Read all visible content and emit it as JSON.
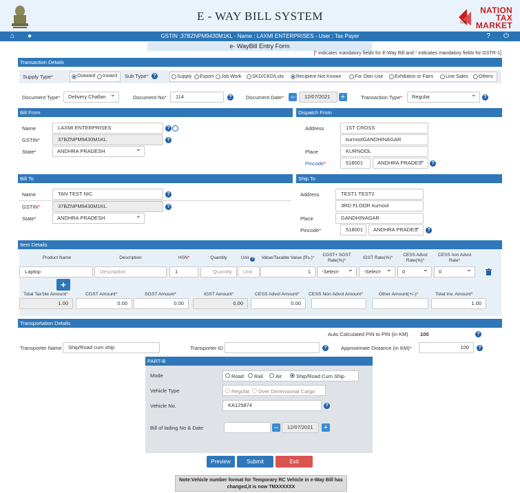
{
  "header": {
    "title": "E - WAY BILL SYSTEM",
    "logo_lines": [
      "NATION",
      "TAX",
      "MARKET"
    ],
    "logo_gst": "GST"
  },
  "navbar": {
    "gst_info": "GSTIN :37BZNPM9430M1KL - Name : LAXMI ENTERPRISES - User : Tax Payer"
  },
  "form_title": "e- WayBill Entry Form",
  "mandatory_note": {
    "pre": "[",
    "star1": "*",
    "mid": " indicates mandatory fields for E-Way Bill and ",
    "star2": "*",
    "post": " indicates mandatory fields for GSTR-1]"
  },
  "transaction": {
    "section_label": "Transaction Details",
    "supply_type_label": "Supply Type",
    "supply_types": [
      "Outward",
      "Inward"
    ],
    "sub_type_label": "Sub Type",
    "sub_types": [
      "Supply",
      "Export",
      "Job Work",
      "SKD/CKD/Lots",
      "Recipient Not Known",
      "For Own Use",
      "Exhibition or Fairs",
      "Line Sales",
      "Others"
    ],
    "document_type_label": "Document Type",
    "document_type_value": "Delivery Challan",
    "document_no_label": "Document No",
    "document_no_value": "114",
    "document_date_label": "Document Date",
    "document_date_value": "12/07/2021",
    "transaction_type_label": "Transaction Type",
    "transaction_type_value": "Regular"
  },
  "bill_from": {
    "section_label": "Bill From",
    "name_label": "Name",
    "name_value": "LAXMI ENTERPRISES",
    "gstin_label": "GSTIN",
    "gstin_value": "37BZNPM9430M1KL",
    "state_label": "State",
    "state_value": "ANDHRA PRADESH"
  },
  "dispatch_from": {
    "section_label": "Dispatch From",
    "address_label": "Address",
    "address1": "1ST CROSS",
    "address2": "kurnoolGANDHINAGAR",
    "place_label": "Place",
    "place_value": "KURNOOL",
    "pincode_label": "Pincode",
    "pincode_value": "518001",
    "state_value": "ANDHRA PRADES"
  },
  "bill_to": {
    "section_label": "Bill To",
    "name_label": "Name",
    "name_value": "TAN TEST NIC",
    "gstin_label": "GSTIN",
    "gstin_value": "37BZNPM9430M1KL",
    "state_label": "State",
    "state_value": "ANDHRA PRADESH"
  },
  "ship_to": {
    "section_label": "Ship To",
    "address_label": "Address",
    "address1": "TEST1 TEST2",
    "address2": "3RD FLOOR kurnool",
    "place_label": "Place",
    "place_value": "GANDHINAGAR",
    "pincode_label": "Pincode",
    "pincode_value": "518001",
    "state_value": "ANDHRA PRADES"
  },
  "items": {
    "section_label": "Item Details",
    "headers": {
      "product": "Product Name",
      "description": "Description",
      "hsn": "HSN",
      "quantity": "Quantity",
      "unit": "Unit",
      "value": "Value/Taxable Value (Rs.)",
      "cgst_sgst": "CGST+ SGST Rate(%)",
      "igst": "IGST Rate(%)",
      "cess_advol": "CESS Advol Rate(%)",
      "cess_non_advol": "CESS non Advol Rate"
    },
    "row": {
      "product": "Laptop",
      "description_placeholder": "Description",
      "hsn": "1",
      "quantity_placeholder": "Quantity",
      "unit_placeholder": "Unit",
      "value": "1",
      "cgst_sgst": "-Select-",
      "igst": "-Select-",
      "cess_advol": "0",
      "cess_non_advol": "0"
    },
    "totals": {
      "total_taxable_label": "Total Tax'ble Amount",
      "total_taxable_value": "1.00",
      "cgst_label": "CGST Amount",
      "cgst_value": "0.00",
      "sgst_label": "SGST Amount",
      "sgst_value": "0.00",
      "igst_label": "IGST Amount",
      "igst_value": "0.00",
      "cess_advol_label": "CESS Advol Amount",
      "cess_advol_value": "0.00",
      "cess_non_advol_label": "CESS Non Advol Amount",
      "cess_non_advol_value": "",
      "other_label": "Other Amount(+/-)",
      "other_value": "",
      "total_inv_label": "Total Inv. Amount",
      "total_inv_value": "1.00"
    }
  },
  "transport": {
    "section_label": "Transportation Details",
    "auto_pin_label": "Auto Calculated PIN to PIN (in KM)",
    "auto_pin_value": "100",
    "transporter_name_label": "Transporter Name",
    "transporter_name_value": "Ship/Road cum ship",
    "transporter_id_label": "Transporter ID",
    "transporter_id_value": "",
    "approx_distance_label": "Approximate Distance (in KM)",
    "approx_distance_value": "100"
  },
  "part_b": {
    "section_label": "PART-B",
    "mode_label": "Mode",
    "modes": [
      "Road",
      "Rail",
      "Air",
      "Ship/Road Cum Ship"
    ],
    "vehicle_type_label": "Vehicle Type",
    "vehicle_types": [
      "Regular",
      "Over Dimensional Cargo"
    ],
    "vehicle_no_label": "Vehicle No.",
    "vehicle_no_value": "KA125874",
    "lading_label": "Bill of lading No & Date",
    "lading_no_value": "",
    "lading_date_value": "12/07/2021"
  },
  "actions": {
    "preview": "Preview",
    "submit": "Submit",
    "exit": "Exit"
  },
  "note": {
    "line1": "Note:Vehicle number format for Temporary RC Vehicle in e-Way Bill has",
    "line2": "changed,it is now TMXXXXXX"
  },
  "colors": {
    "section_blue": "#2f77b8",
    "navbar_blue": "#2a74b6",
    "exit_red": "#d9534f",
    "required_red": "#dd0000"
  }
}
